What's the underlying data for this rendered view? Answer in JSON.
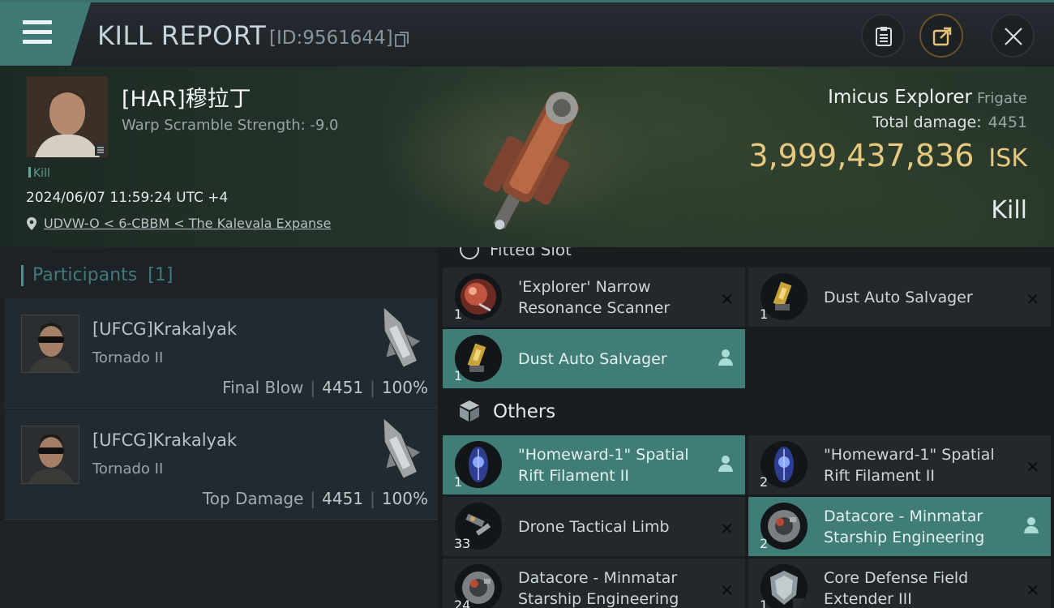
{
  "topbar": {
    "title": "KILL REPORT",
    "kill_id": "[ID:9561644]"
  },
  "victim": {
    "pilot_name": "[HAR]穆拉丁",
    "warp_scramble": "Warp Scramble Strength: -9.0",
    "kill_tag": "Kill",
    "datetime": "2024/06/07 11:59:24 UTC +4",
    "location": "UDVW-O < 6-CBBM < The Kalevala Expanse",
    "ship_name": "Imicus Explorer",
    "ship_class": "Frigate",
    "total_damage_label": "Total damage:",
    "total_damage": "4451",
    "isk_value": "3,999,437,836",
    "isk_unit": "ISK",
    "result": "Kill"
  },
  "participants": {
    "header": "Participants",
    "count": "[1]",
    "rows": [
      {
        "name": "[UFCG]Krakalyak",
        "ship": "Tornado II",
        "label": "Final Blow",
        "damage": "4451",
        "percent": "100%"
      },
      {
        "name": "[UFCG]Krakalyak",
        "ship": "Tornado II",
        "label": "Top Damage",
        "damage": "4451",
        "percent": "100%"
      }
    ]
  },
  "items": {
    "fitted_header": "Fitted Slot",
    "fitted": [
      {
        "name": "'Explorer' Narrow Resonance Scanner",
        "qty": "1",
        "dropped": false,
        "icon": "scanner-icon"
      },
      {
        "name": "Dust Auto Salvager",
        "qty": "1",
        "dropped": false,
        "icon": "salvager-icon"
      },
      {
        "name": "Dust Auto Salvager",
        "qty": "1",
        "dropped": true,
        "icon": "salvager-icon"
      }
    ],
    "others_header": "Others",
    "others": [
      {
        "name": "\"Homeward-1\" Spatial Rift Filament II",
        "qty": "1",
        "dropped": true,
        "icon": "filament-icon"
      },
      {
        "name": "\"Homeward-1\" Spatial Rift Filament II",
        "qty": "2",
        "dropped": false,
        "icon": "filament-icon"
      },
      {
        "name": "Drone Tactical Limb",
        "qty": "33",
        "dropped": false,
        "icon": "drone-limb-icon"
      },
      {
        "name": "Datacore - Minmatar Starship Engineering",
        "qty": "2",
        "dropped": true,
        "icon": "datacore-icon"
      },
      {
        "name": "Datacore - Minmatar Starship Engineering",
        "qty": "24",
        "dropped": false,
        "icon": "datacore-icon"
      },
      {
        "name": "Core Defense Field Extender III",
        "qty": "1",
        "dropped": false,
        "icon": "rig-icon"
      }
    ]
  },
  "colors": {
    "accent": "#3f7d76",
    "isk": "#e8c77f"
  }
}
